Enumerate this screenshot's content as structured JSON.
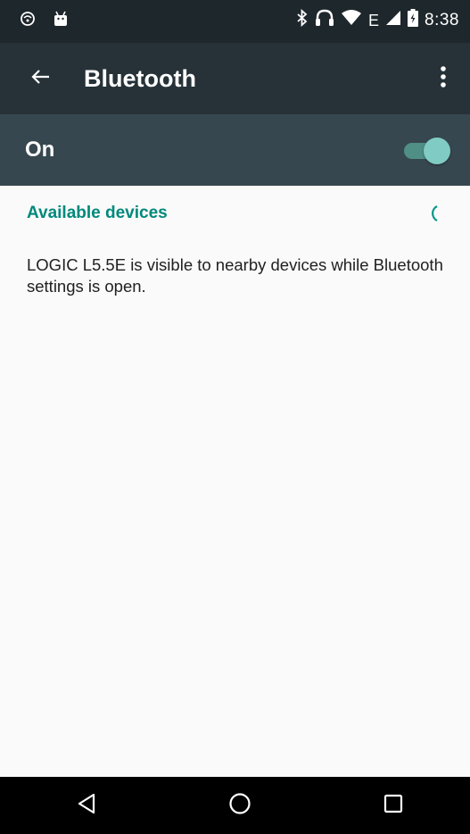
{
  "status_bar": {
    "time": "8:38",
    "left_icons": [
      "notification-icon",
      "android-icon"
    ],
    "right_icons": [
      "bluetooth-icon",
      "headphones-icon",
      "wifi-icon",
      "network-type-label",
      "signal-icon",
      "battery-icon"
    ],
    "network_type": "E"
  },
  "app_bar": {
    "title": "Bluetooth",
    "back_icon": "arrow-back-icon",
    "overflow_icon": "more-vert-icon"
  },
  "bluetooth_switch": {
    "label": "On",
    "checked": true
  },
  "available_devices": {
    "header": "Available devices",
    "scanning_icon": "progress-spinner-icon"
  },
  "visibility_message": "LOGIC L5.5E is visible to nearby devices while Bluetooth settings is open.",
  "nav_bar": {
    "buttons": [
      "back-triangle-icon",
      "home-circle-icon",
      "recents-square-icon"
    ]
  },
  "colors": {
    "status_bar": "#1e272c",
    "app_bar": "#263238",
    "switch_bar": "#37474f",
    "accent": "#009688",
    "toggle_thumb": "#80cbc4",
    "background": "#fafafa"
  }
}
